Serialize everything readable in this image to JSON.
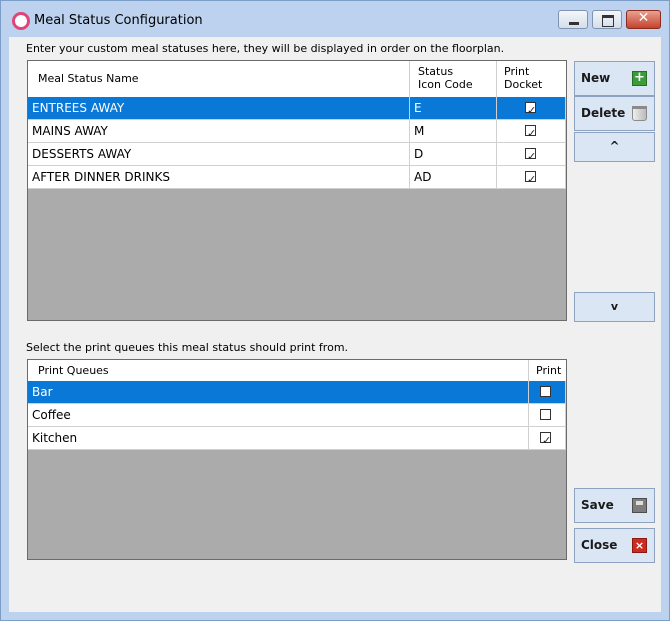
{
  "window": {
    "title": "Meal Status Configuration",
    "controls": {
      "minimize": "",
      "maximize": "",
      "close": "✕"
    }
  },
  "statuses": {
    "caption": "Enter your custom meal statuses here, they will be displayed in order on the floorplan.",
    "columns": {
      "name": "Meal Status Name",
      "code_line1": "Status",
      "code_line2": "Icon Code",
      "print_line1": "Print",
      "print_line2": "Docket"
    },
    "rows": [
      {
        "name": "ENTREES AWAY",
        "code": "E",
        "print_docket": true,
        "selected": true
      },
      {
        "name": "MAINS AWAY",
        "code": "M",
        "print_docket": true,
        "selected": false
      },
      {
        "name": "DESSERTS AWAY",
        "code": "D",
        "print_docket": true,
        "selected": false
      },
      {
        "name": "AFTER DINNER DRINKS",
        "code": "AD",
        "print_docket": true,
        "selected": false
      }
    ]
  },
  "queues": {
    "caption": "Select the print queues this meal status should print from.",
    "columns": {
      "name": "Print Queues",
      "print": "Print"
    },
    "rows": [
      {
        "name": "Bar",
        "print": false,
        "selected": true
      },
      {
        "name": "Coffee",
        "print": false,
        "selected": false
      },
      {
        "name": "Kitchen",
        "print": true,
        "selected": false
      }
    ]
  },
  "buttons": {
    "new": "New",
    "delete": "Delete",
    "up": "^",
    "down": "v",
    "save": "Save",
    "close": "Close"
  },
  "icons": {
    "app": "ring-icon",
    "new": "plus-icon",
    "delete": "trash-icon",
    "save": "disk-icon",
    "close": "x-icon"
  },
  "colors": {
    "selection": "#0a78d6",
    "frame": "#bcd2ee",
    "button": "#dbe6f5",
    "grid_empty": "#ababab"
  }
}
